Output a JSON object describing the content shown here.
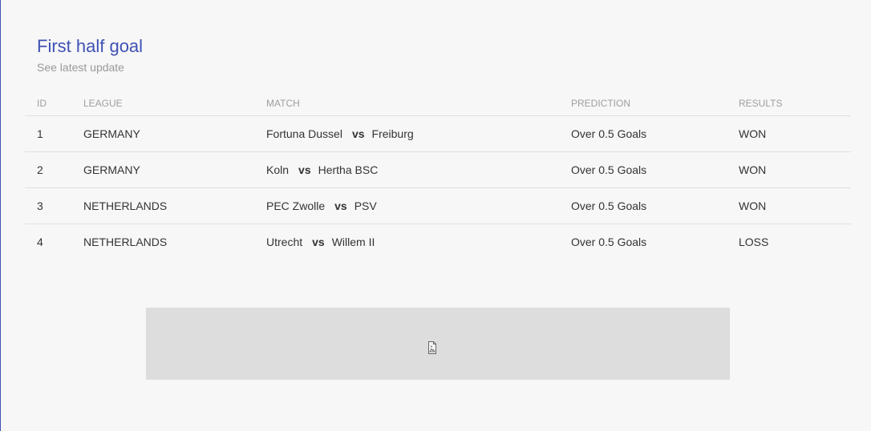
{
  "header": {
    "title": "First half goal",
    "subtitle": "See latest update"
  },
  "table": {
    "columns": {
      "id": "ID",
      "league": "LEAGUE",
      "match": "MATCH",
      "prediction": "PREDICTION",
      "results": "RESULTS"
    },
    "rows": [
      {
        "id": "1",
        "league": "GERMANY",
        "home": "Fortuna Dussel",
        "vs": "vs",
        "away": "Freiburg",
        "prediction": "Over 0.5 Goals",
        "result": "WON"
      },
      {
        "id": "2",
        "league": "GERMANY",
        "home": "Koln",
        "vs": "vs",
        "away": "Hertha BSC",
        "prediction": "Over 0.5 Goals",
        "result": "WON"
      },
      {
        "id": "3",
        "league": "NETHERLANDS",
        "home": "PEC Zwolle",
        "vs": "vs",
        "away": "PSV",
        "prediction": "Over 0.5 Goals",
        "result": "WON"
      },
      {
        "id": "4",
        "league": "NETHERLANDS",
        "home": "Utrecht",
        "vs": "vs",
        "away": "Willem II",
        "prediction": "Over 0.5 Goals",
        "result": "LOSS"
      }
    ]
  },
  "ad": {
    "icon": "broken-image-icon"
  },
  "colors": {
    "accent": "#3f51b5",
    "background": "#f7f7f7",
    "ad_placeholder": "#dddddd"
  }
}
